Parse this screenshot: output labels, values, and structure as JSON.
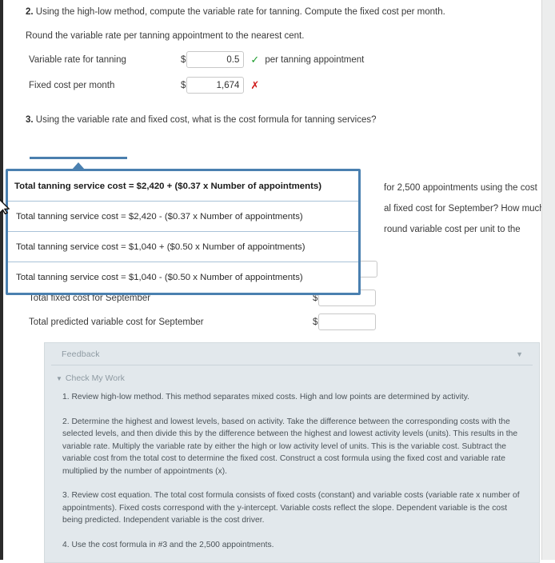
{
  "question2": {
    "number": "2.",
    "line1": "Using the high-low method, compute the variable rate for tanning. Compute the fixed cost per month.",
    "line2": "Round the variable rate per tanning appointment to the nearest cent.",
    "rows": [
      {
        "label": "Variable rate for tanning",
        "currency": "$",
        "value": "0.5",
        "mark": "✓",
        "mark_state": "correct",
        "suffix": "per tanning appointment"
      },
      {
        "label": "Fixed cost per month",
        "currency": "$",
        "value": "1,674",
        "mark": "✗",
        "mark_state": "incorrect",
        "suffix": ""
      }
    ]
  },
  "question3": {
    "number": "3.",
    "text": "Using the variable rate and fixed cost, what is the cost formula for tanning services?"
  },
  "formula_dropdown": {
    "expanded": true,
    "selected_index": 0,
    "options": [
      "Total tanning service cost = $2,420 + ($0.37 x Number of appointments)",
      "Total tanning service cost = $2,420 - ($0.37 x Number of appointments)",
      "Total tanning service cost = $1,040 + ($0.50 x Number of appointments)",
      "Total tanning service cost = $1,040 - ($0.50 x Number of appointments)"
    ]
  },
  "question4_background": {
    "visible_fragments": [
      "for 2,500 appointments using the cost",
      "al fixed cost for September? How much",
      "round variable cost per unit to the"
    ]
  },
  "september_rows": [
    {
      "label": "Total fixed cost for September",
      "currency": "$",
      "value": ""
    },
    {
      "label": "Total predicted variable cost for September",
      "currency": "$",
      "value": ""
    }
  ],
  "feedback": {
    "title": "Feedback",
    "collapse_icon": "▼",
    "check_my_work_label": "Check My Work",
    "check_my_work_icon": "▼",
    "paragraphs": [
      "1. Review high-low method. This method separates mixed costs. High and low points are determined by activity.",
      "2. Determine the highest and lowest levels, based on activity. Take the difference between the corresponding costs with the selected levels, and then divide this by the difference between the highest and lowest activity levels (units). This results in the variable rate. Multiply the variable rate by either the high or low activity level of units. This is the variable cost. Subtract the variable cost from the total cost to determine the fixed cost. Construct a cost formula using the fixed cost and variable rate multiplied by the number of appointments (x).",
      "3. Review cost equation. The total cost formula consists of fixed costs (constant) and variable costs (variable rate x number of appointments). Fixed costs correspond with the y-intercept. Variable costs reflect the slope. Dependent variable is the cost being predicted. Independent variable is the cost driver.",
      "4. Use the cost formula in #3 and the 2,500 appointments."
    ]
  },
  "colors": {
    "accent_blue": "#4a80b0",
    "correct_green": "#1f9d2f",
    "incorrect_red": "#d01a1a",
    "feedback_bg": "#e2e8ec"
  }
}
